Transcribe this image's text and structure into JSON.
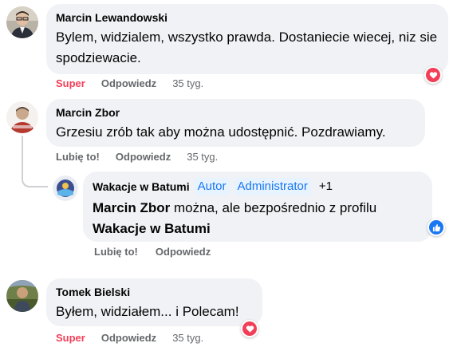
{
  "comments": [
    {
      "author": "Marcin Lewandowski",
      "text": "Bylem, widzialem, wszystko prawda. Dostaniecie wiecej, niz sie spodziewacie.",
      "reaction_label": "Super",
      "reply_label": "Odpowiedz",
      "time": "35 tyg.",
      "reaction_icon": "heart-icon"
    },
    {
      "author": "Marcin Zbor",
      "text": "Grzesiu zrób tak aby można udostępnić. Pozdrawiamy.",
      "reaction_label": "Lubię to!",
      "reply_label": "Odpowiedz",
      "time": "35 tyg."
    },
    {
      "author": "Tomek Bielski",
      "text": "Byłem, widziałem... i Polecam!",
      "reaction_label": "Super",
      "reply_label": "Odpowiedz",
      "time": "35 tyg.",
      "reaction_icon": "heart-icon"
    }
  ],
  "reply": {
    "author": "Wakacje w Batumi",
    "badges": [
      "Autor",
      "Administrator",
      "+1"
    ],
    "mention_1": "Marcin Zbor",
    "text_mid": " można, ale bezpośrednio z profilu",
    "mention_2": "Wakacje w Batumi",
    "like_label": "Lubię to!",
    "reply_label": "Odpowiedz",
    "reaction_icon": "like-icon"
  },
  "colors": {
    "bubble": "#f0f2f5",
    "super": "#f33e58",
    "like": "#1877f2",
    "meta": "#65676b"
  }
}
